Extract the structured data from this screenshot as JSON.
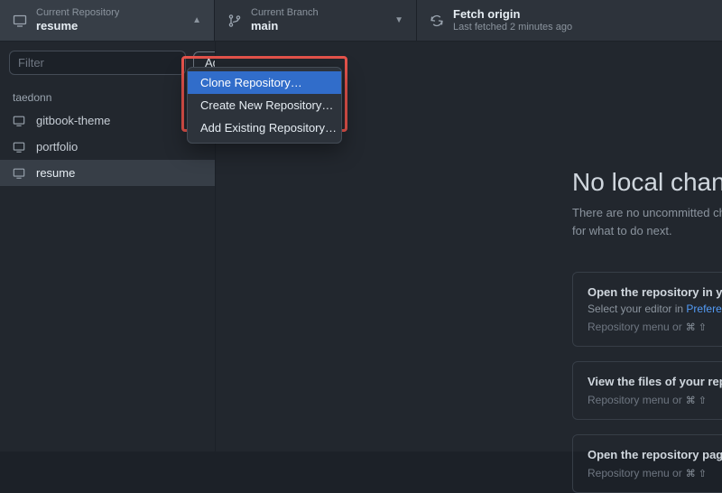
{
  "topbar": {
    "repo": {
      "label": "Current Repository",
      "value": "resume"
    },
    "branch": {
      "label": "Current Branch",
      "value": "main"
    },
    "fetch": {
      "title": "Fetch origin",
      "sub": "Last fetched 2 minutes ago"
    }
  },
  "sidebar": {
    "filter_placeholder": "Filter",
    "add_label": "Add",
    "owner": "taedonn",
    "repos": [
      {
        "name": "gitbook-theme",
        "active": false
      },
      {
        "name": "portfolio",
        "active": false
      },
      {
        "name": "resume",
        "active": true
      }
    ]
  },
  "dropdown": {
    "items": [
      {
        "label": "Clone Repository…",
        "selected": true
      },
      {
        "label": "Create New Repository…",
        "selected": false
      },
      {
        "label": "Add Existing Repository…",
        "selected": false
      }
    ]
  },
  "main": {
    "title": "No local changes",
    "subtitle_l1": "There are no uncommitted changes",
    "subtitle_l2": "for what to do next.",
    "cards": [
      {
        "title": "Open the repository in your editor",
        "sub_pre": "Select your editor in ",
        "sub_link": "Preferences",
        "menu": "Repository menu or",
        "kbd": "⌘ ⇧"
      },
      {
        "title": "View the files of your repository",
        "sub_pre": "",
        "sub_link": "",
        "menu": "Repository menu or",
        "kbd": "⌘ ⇧"
      },
      {
        "title": "Open the repository page",
        "sub_pre": "",
        "sub_link": "",
        "menu": "Repository menu or",
        "kbd": "⌘ ⇧"
      }
    ]
  }
}
